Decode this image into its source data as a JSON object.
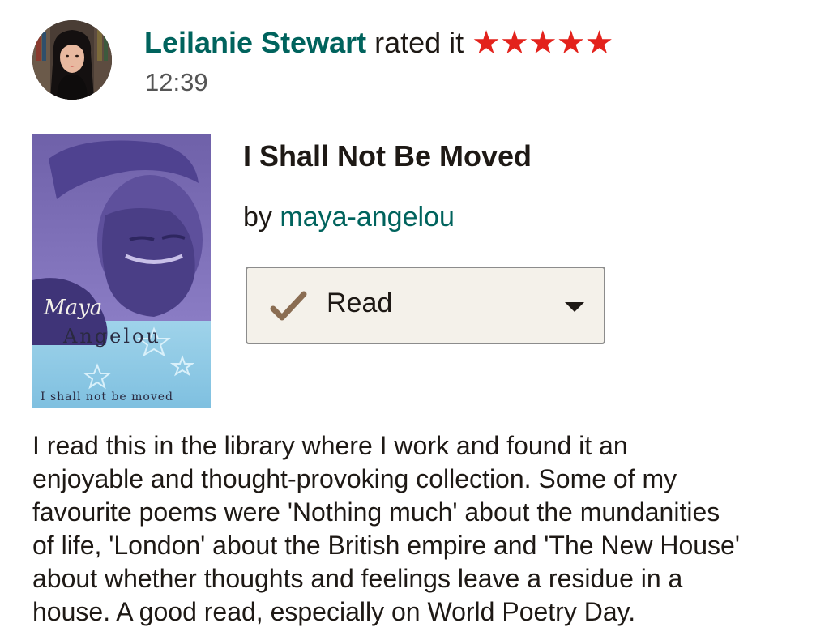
{
  "header": {
    "user_name": "Leilanie Stewart",
    "action_text": "rated it",
    "rating": 5,
    "rating_max": 5,
    "timestamp": "12:39"
  },
  "book": {
    "title": "I Shall Not Be Moved",
    "by_label": "by",
    "author": "maya-angelou",
    "cover_text": {
      "first_name": "Maya",
      "last_name": "Angelou",
      "title": "I shall not be moved"
    }
  },
  "shelf": {
    "label": "Read",
    "icon": "checkmark-icon"
  },
  "review": {
    "lines": [
      "I read this in the library where I work and found it an",
      "enjoyable and thought-provoking collection. Some of my",
      "favourite poems were 'Nothing much' about the mundanities",
      "of life, 'London' about the British empire and 'The New House'",
      "about whether thoughts and feelings leave a residue in a",
      "house. A good read, especially on World Poetry Day."
    ]
  },
  "colors": {
    "accent_teal": "#00635d",
    "star_red": "#e3221c",
    "check_brown": "#8a6d52",
    "dropdown_bg": "#f4f1ea",
    "cover_purple": "#7a6cb2",
    "cover_blue": "#8fcbe6"
  }
}
